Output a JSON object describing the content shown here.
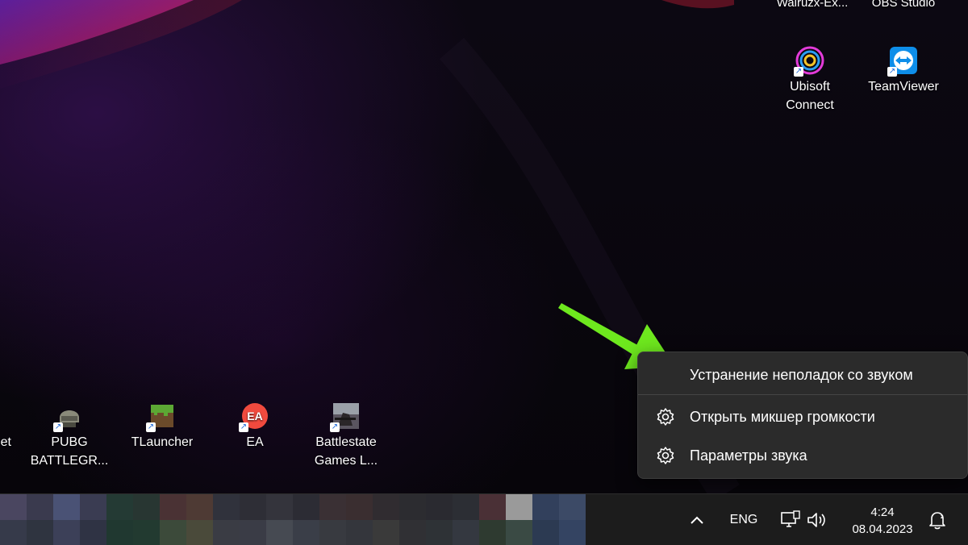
{
  "desktop": {
    "top_labels": [
      {
        "label": "Walruzx-Ex...",
        "icon": "app-icon"
      },
      {
        "label": "OBS Studio",
        "icon": "obs-icon"
      }
    ],
    "icons_top": [
      {
        "label": "Ubisoft\nConnect",
        "icon": "ubisoft-connect-icon"
      },
      {
        "label": "TeamViewer",
        "icon": "teamviewer-icon"
      }
    ],
    "icons_bottom": [
      {
        "label": "et",
        "icon": "app-icon"
      },
      {
        "label": "PUBG\nBATTLEGR...",
        "icon": "pubg-icon"
      },
      {
        "label": "TLauncher",
        "icon": "tlauncher-icon"
      },
      {
        "label": "EA",
        "icon": "ea-icon"
      },
      {
        "label": "Battlestate\nGames L...",
        "icon": "battlestate-games-icon"
      }
    ]
  },
  "context_menu": {
    "items": [
      {
        "label": "Устранение неполадок со звуком",
        "icon": null
      },
      {
        "label": "Открыть микшер громкости",
        "icon": "gear-icon"
      },
      {
        "label": "Параметры звука",
        "icon": "gear-icon"
      }
    ]
  },
  "annotation": {
    "type": "arrow",
    "color": "#6ee81e",
    "points_to": "Устранение неполадок со звуком"
  },
  "taskbar": {
    "pinned_apps": "blurred",
    "tray": {
      "chevron_icon": "chevron-up-icon",
      "language": "ENG",
      "network_icon": "network-icon",
      "volume_icon": "speaker-icon",
      "notification_icon": "notification-bell-icon"
    },
    "clock": {
      "time": "4:24",
      "date": "08.04.2023"
    }
  },
  "colors": {
    "accent_green": "#6ee81e",
    "menu_bg": "#2b2b2b",
    "taskbar_bg": "#1c1c1c"
  }
}
